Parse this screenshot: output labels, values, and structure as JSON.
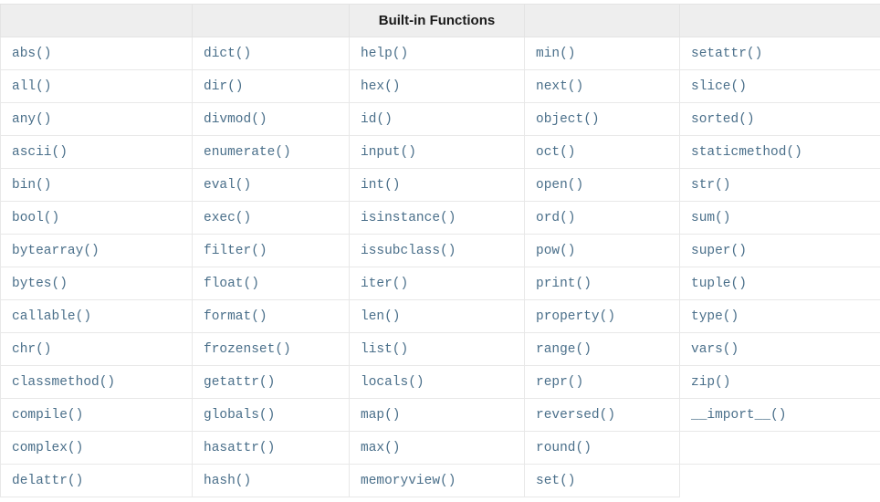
{
  "table": {
    "title": "Built-in Functions",
    "header_cells": [
      "",
      "",
      "Built-in Functions",
      "",
      ""
    ],
    "header_title_column_index": 2,
    "column_count": 5,
    "row_count": 14,
    "columns": [
      {
        "index": 0,
        "cells": [
          "abs()",
          "all()",
          "any()",
          "ascii()",
          "bin()",
          "bool()",
          "bytearray()",
          "bytes()",
          "callable()",
          "chr()",
          "classmethod()",
          "compile()",
          "complex()",
          "delattr()"
        ]
      },
      {
        "index": 1,
        "cells": [
          "dict()",
          "dir()",
          "divmod()",
          "enumerate()",
          "eval()",
          "exec()",
          "filter()",
          "float()",
          "format()",
          "frozenset()",
          "getattr()",
          "globals()",
          "hasattr()",
          "hash()"
        ]
      },
      {
        "index": 2,
        "cells": [
          "help()",
          "hex()",
          "id()",
          "input()",
          "int()",
          "isinstance()",
          "issubclass()",
          "iter()",
          "len()",
          "list()",
          "locals()",
          "map()",
          "max()",
          "memoryview()"
        ]
      },
      {
        "index": 3,
        "cells": [
          "min()",
          "next()",
          "object()",
          "oct()",
          "open()",
          "ord()",
          "pow()",
          "print()",
          "property()",
          "range()",
          "repr()",
          "reversed()",
          "round()",
          "set()"
        ]
      },
      {
        "index": 4,
        "cells": [
          "setattr()",
          "slice()",
          "sorted()",
          "staticmethod()",
          "str()",
          "sum()",
          "super()",
          "tuple()",
          "type()",
          "vars()",
          "zip()",
          "__import__()",
          "",
          ""
        ]
      }
    ],
    "rows": [
      [
        "abs()",
        "dict()",
        "help()",
        "min()",
        "setattr()"
      ],
      [
        "all()",
        "dir()",
        "hex()",
        "next()",
        "slice()"
      ],
      [
        "any()",
        "divmod()",
        "id()",
        "object()",
        "sorted()"
      ],
      [
        "ascii()",
        "enumerate()",
        "input()",
        "oct()",
        "staticmethod()"
      ],
      [
        "bin()",
        "eval()",
        "int()",
        "open()",
        "str()"
      ],
      [
        "bool()",
        "exec()",
        "isinstance()",
        "ord()",
        "sum()"
      ],
      [
        "bytearray()",
        "filter()",
        "issubclass()",
        "pow()",
        "super()"
      ],
      [
        "bytes()",
        "float()",
        "iter()",
        "print()",
        "tuple()"
      ],
      [
        "callable()",
        "format()",
        "len()",
        "property()",
        "type()"
      ],
      [
        "chr()",
        "frozenset()",
        "list()",
        "range()",
        "vars()"
      ],
      [
        "classmethod()",
        "getattr()",
        "locals()",
        "repr()",
        "zip()"
      ],
      [
        "compile()",
        "globals()",
        "map()",
        "reversed()",
        "__import__()"
      ],
      [
        "complex()",
        "hasattr()",
        "max()",
        "round()",
        ""
      ],
      [
        "delattr()",
        "hash()",
        "memoryview()",
        "set()",
        ""
      ]
    ],
    "colors": {
      "header_background": "#eeeeee",
      "header_text": "#1a1a1a",
      "cell_text": "#4a6f8a",
      "cell_background": "#ffffff",
      "grid_line": "#e8e8e8"
    }
  }
}
